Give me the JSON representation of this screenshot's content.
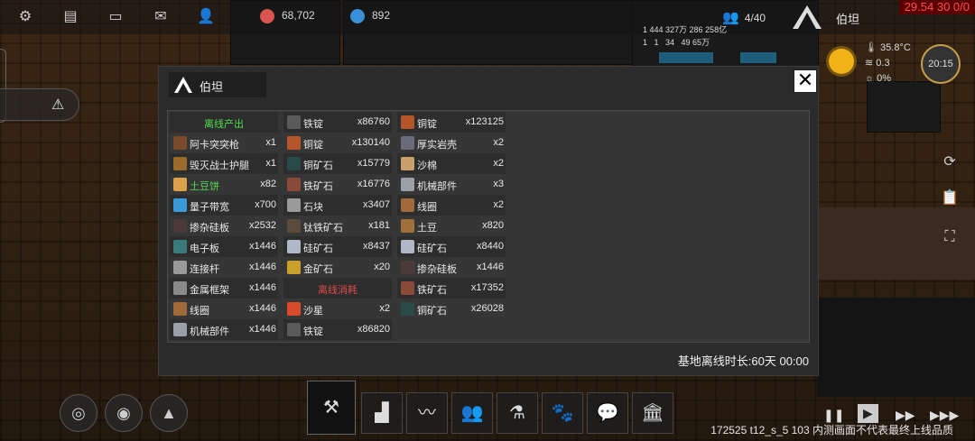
{
  "topbar": {
    "icons": [
      "gear-icon",
      "chat-icon",
      "message-icon",
      "mail-icon",
      "user-icon"
    ],
    "resource_a": "68,702",
    "resource_b": "892",
    "population": "4/40",
    "base_name": "伯坦",
    "stats": "29.54 30 0/0",
    "mini_text": "1 444 327万 286 258亿\n1   1   34   49 65万"
  },
  "weather": {
    "temperature": "35.8°C",
    "wind": "0.3",
    "rain": "0%",
    "time": "20:15"
  },
  "modal": {
    "tab_title": "伯坦",
    "close_label": "✕",
    "footer": "基地离线时长:60天 00:00",
    "columns": [
      [
        {
          "header": "离线产出",
          "color": "#4fdc4f"
        },
        {
          "name": "阿卡突突枪",
          "qty": "x1",
          "icon_color": "#7a4a2a"
        },
        {
          "name": "毁灭战士护腿",
          "qty": "x1",
          "icon_color": "#9a6a2a"
        },
        {
          "name": "土豆饼",
          "qty": "x82",
          "icon_color": "#d9a24a",
          "name_color": "#4fdc4f"
        },
        {
          "name": "量子带宽",
          "qty": "x700",
          "icon_color": "#3a9ad9"
        },
        {
          "name": "掺杂硅板",
          "qty": "x2532",
          "icon_color": "#4a3a3a"
        },
        {
          "name": "电子板",
          "qty": "x1446",
          "icon_color": "#3a7a7a"
        },
        {
          "name": "连接杆",
          "qty": "x1446",
          "icon_color": "#9a9a9a"
        },
        {
          "name": "金属框架",
          "qty": "x1446",
          "icon_color": "#8a8a8a"
        },
        {
          "name": "线圈",
          "qty": "x1446",
          "icon_color": "#a06a3a"
        },
        {
          "name": "机械部件",
          "qty": "x1446",
          "icon_color": "#9aa0a8"
        }
      ],
      [
        {
          "name": "铁锭",
          "qty": "x86760",
          "icon_color": "#5a5a5a"
        },
        {
          "name": "铜锭",
          "qty": "x130140",
          "icon_color": "#b5552a"
        },
        {
          "name": "铜矿石",
          "qty": "x15779",
          "icon_color": "#2a4a4a"
        },
        {
          "name": "铁矿石",
          "qty": "x16776",
          "icon_color": "#8a4a3a"
        },
        {
          "name": "石块",
          "qty": "x3407",
          "icon_color": "#9a9a9a"
        },
        {
          "name": "钛铁矿石",
          "qty": "x181",
          "icon_color": "#5a4a3a"
        },
        {
          "name": "硅矿石",
          "qty": "x8437",
          "icon_color": "#b0b8c8"
        },
        {
          "name": "金矿石",
          "qty": "x20",
          "icon_color": "#c9a02a"
        },
        {
          "header": "离线消耗",
          "color": "#e04a4a"
        },
        {
          "name": "沙星",
          "qty": "x2",
          "icon_color": "#d94a2a"
        },
        {
          "name": "铁锭",
          "qty": "x86820",
          "icon_color": "#5a5a5a"
        }
      ],
      [
        {
          "name": "铜锭",
          "qty": "x123125",
          "icon_color": "#b5552a"
        },
        {
          "name": "厚实岩壳",
          "qty": "x2",
          "icon_color": "#6a6a7a"
        },
        {
          "name": "沙棉",
          "qty": "x2",
          "icon_color": "#c9a06a"
        },
        {
          "name": "机械部件",
          "qty": "x3",
          "icon_color": "#9aa0a8"
        },
        {
          "name": "线圈",
          "qty": "x2",
          "icon_color": "#a06a3a"
        },
        {
          "name": "土豆",
          "qty": "x820",
          "icon_color": "#a0703a"
        },
        {
          "name": "硅矿石",
          "qty": "x8440",
          "icon_color": "#b0b8c8"
        },
        {
          "name": "掺杂硅板",
          "qty": "x1446",
          "icon_color": "#4a3a3a"
        },
        {
          "name": "铁矿石",
          "qty": "x17352",
          "icon_color": "#8a4a3a"
        },
        {
          "name": "铜矿石",
          "qty": "x26028",
          "icon_color": "#2a4a4a"
        }
      ]
    ]
  },
  "bottombar": {
    "left_buttons": [
      "galaxy-icon",
      "orbit-icon",
      "mountain-icon"
    ],
    "main_buttons": [
      "build-tools-icon",
      "blueprint-icon",
      "audio-wave-icon",
      "people-icon",
      "research-flask-icon",
      "animal-icon",
      "chat-dots-icon",
      "bank-icon"
    ],
    "version": "172525 t12_s_5 103  内测画面不代表最终上线品质"
  }
}
